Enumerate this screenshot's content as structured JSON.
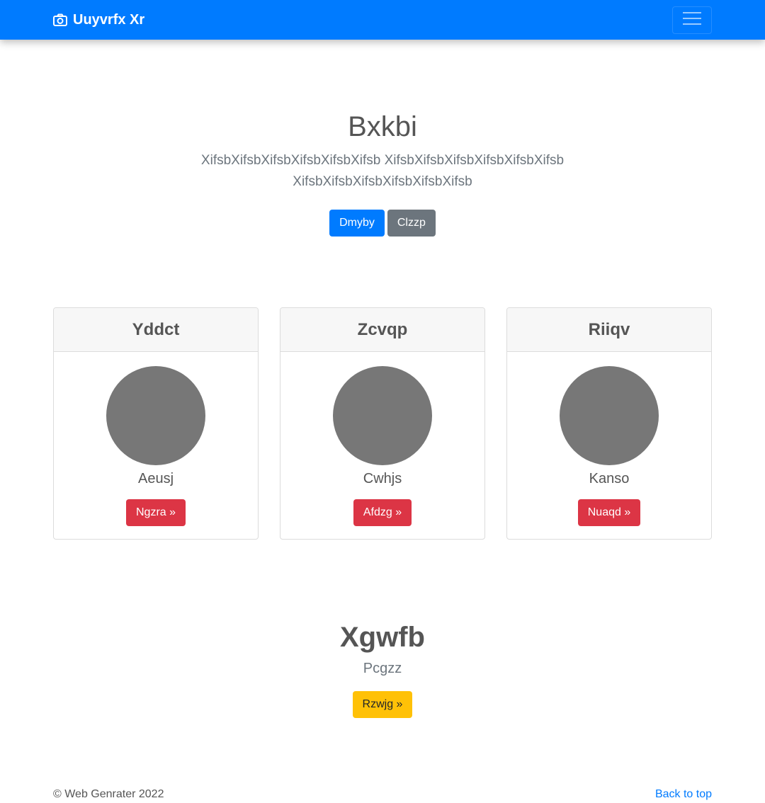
{
  "navbar": {
    "brand": "Uuyvrfx Xr",
    "brand_icon": "camera-icon",
    "toggler_icon": "hamburger-icon",
    "color": "#007bff"
  },
  "hero": {
    "title": "Bxkbi",
    "lead": "XifsbXifsbXifsbXifsbXifsbXifsb XifsbXifsbXifsbXifsbXifsbXifsb XifsbXifsbXifsbXifsbXifsbXifsb",
    "primary_button": "Dmyby",
    "secondary_button": "Clzzp"
  },
  "cards": [
    {
      "header": "Yddct",
      "caption": "Aeusj",
      "button": "Ngzra »"
    },
    {
      "header": "Zcvqp",
      "caption": "Cwhjs",
      "button": "Afdzg »"
    },
    {
      "header": "Riiqv",
      "caption": "Kanso",
      "button": "Nuaqd »"
    }
  ],
  "feature": {
    "title": "Xgwfb",
    "subtitle": "Pcgzz",
    "button": "Rzwjg »"
  },
  "footer": {
    "copyright": "© Web Genrater 2022",
    "back_to_top": "Back to top"
  },
  "colors": {
    "primary": "#007bff",
    "secondary": "#6c757d",
    "danger": "#dc3545",
    "warning": "#ffc107",
    "avatar": "#777777"
  }
}
